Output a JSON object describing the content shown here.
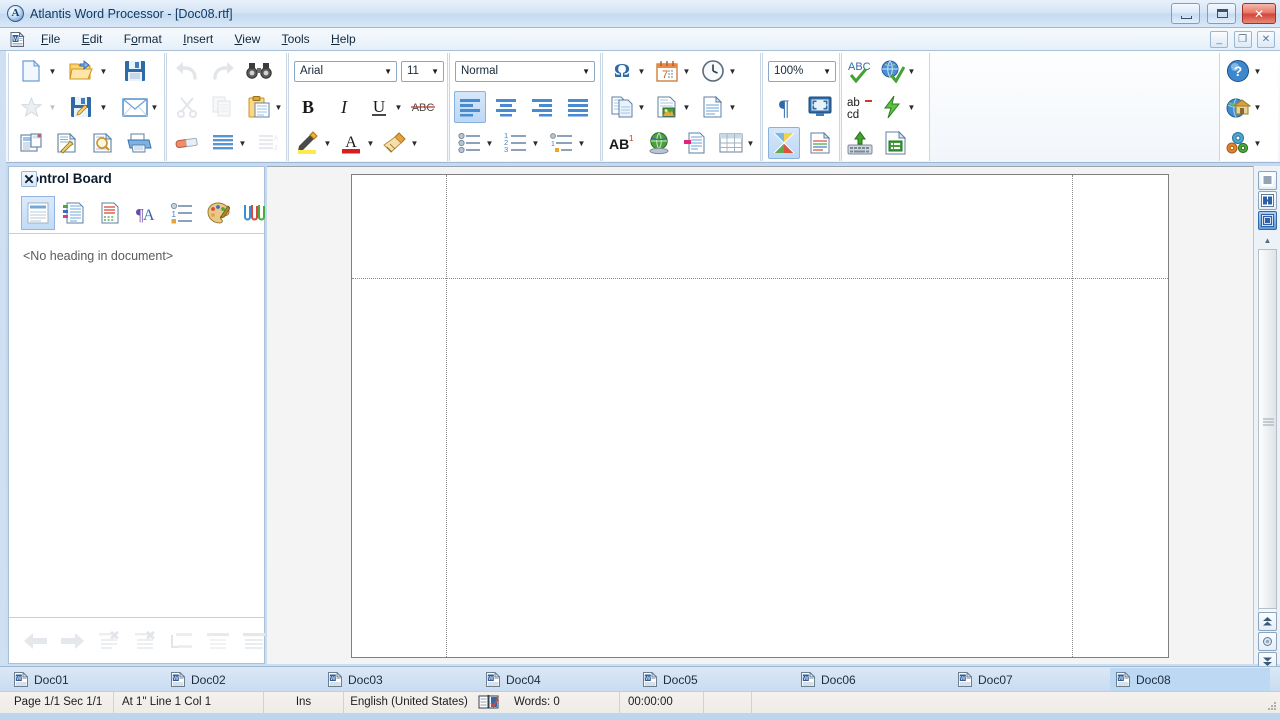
{
  "window": {
    "title": "Atlantis Word Processor - [Doc08.rtf]",
    "app_icon": "atlantis-logo-icon",
    "controls": [
      {
        "name": "minimize",
        "glyph": "minimize-icon"
      },
      {
        "name": "maximize",
        "glyph": "maximize-icon"
      },
      {
        "name": "close",
        "glyph": "✕"
      }
    ],
    "mdi_controls": [
      {
        "name": "mdi-minimize",
        "glyph": "_"
      },
      {
        "name": "mdi-restore",
        "glyph": "❐"
      },
      {
        "name": "mdi-close",
        "glyph": "✕"
      }
    ]
  },
  "menubar": {
    "doc_icon": "document-icon",
    "items": [
      {
        "label": "File",
        "accel": "F"
      },
      {
        "label": "Edit",
        "accel": "E"
      },
      {
        "label": "Format",
        "accel": "o"
      },
      {
        "label": "Insert",
        "accel": "I"
      },
      {
        "label": "View",
        "accel": "V"
      },
      {
        "label": "Tools",
        "accel": "T"
      },
      {
        "label": "Help",
        "accel": "H"
      }
    ]
  },
  "toolbar": {
    "font_name": {
      "value": "Arial",
      "placeholder": "Font"
    },
    "font_size": {
      "value": "11",
      "placeholder": "Size"
    },
    "style": {
      "value": "Normal",
      "placeholder": "Style"
    },
    "zoom": {
      "value": "100%",
      "placeholder": "Zoom"
    },
    "buttons": [
      {
        "name": "new-document-button",
        "icon": "new-page-icon",
        "dropdown": true,
        "enabled": true
      },
      {
        "name": "open-document-button",
        "icon": "open-folder-icon",
        "dropdown": true,
        "enabled": true
      },
      {
        "name": "save-button",
        "icon": "floppy-save-icon",
        "dropdown": false,
        "enabled": true
      },
      {
        "name": "favorites-button",
        "icon": "star-icon",
        "dropdown": true,
        "enabled": false
      },
      {
        "name": "save-as-button",
        "icon": "floppy-pencil-icon",
        "dropdown": true,
        "enabled": true
      },
      {
        "name": "send-mail-button",
        "icon": "envelope-icon",
        "dropdown": true,
        "enabled": true
      },
      {
        "name": "page-setup-button",
        "icon": "page-layout-icon",
        "dropdown": false,
        "enabled": true
      },
      {
        "name": "document-options-button",
        "icon": "page-wrench-icon",
        "dropdown": false,
        "enabled": true
      },
      {
        "name": "print-preview-button",
        "icon": "page-magnifier-icon",
        "dropdown": false,
        "enabled": true
      },
      {
        "name": "print-button",
        "icon": "printer-icon",
        "dropdown": false,
        "enabled": true
      },
      {
        "name": "undo-button",
        "icon": "undo-arrow-icon",
        "dropdown": false,
        "enabled": false
      },
      {
        "name": "redo-button",
        "icon": "redo-arrow-icon",
        "dropdown": false,
        "enabled": false
      },
      {
        "name": "find-button",
        "icon": "binoculars-icon",
        "dropdown": false,
        "enabled": true
      },
      {
        "name": "cut-button",
        "icon": "scissors-icon",
        "dropdown": false,
        "enabled": false
      },
      {
        "name": "copy-button",
        "icon": "copy-pages-icon",
        "dropdown": false,
        "enabled": false
      },
      {
        "name": "paste-button",
        "icon": "clipboard-paste-icon",
        "dropdown": true,
        "enabled": true
      },
      {
        "name": "clear-formatting-button",
        "icon": "eraser-icon",
        "dropdown": false,
        "enabled": true
      },
      {
        "name": "paragraph-format-button",
        "icon": "lines-block-icon",
        "dropdown": true,
        "enabled": true
      },
      {
        "name": "sort-button",
        "icon": "sort-lines-icon",
        "dropdown": false,
        "enabled": false
      },
      {
        "name": "bold-button",
        "icon": "bold-icon",
        "dropdown": false,
        "enabled": true
      },
      {
        "name": "italic-button",
        "icon": "italic-icon",
        "dropdown": false,
        "enabled": true
      },
      {
        "name": "underline-button",
        "icon": "underline-icon",
        "dropdown": true,
        "enabled": true
      },
      {
        "name": "strikethrough-button",
        "icon": "strikethrough-icon",
        "dropdown": false,
        "enabled": true
      },
      {
        "name": "highlight-button",
        "icon": "highlighter-pen-icon",
        "dropdown": true,
        "enabled": true
      },
      {
        "name": "font-color-button",
        "icon": "font-color-icon",
        "dropdown": true,
        "enabled": true
      },
      {
        "name": "format-painter-button",
        "icon": "paint-brush-icon",
        "dropdown": true,
        "enabled": true
      },
      {
        "name": "align-left-button",
        "icon": "align-left-icon",
        "dropdown": false,
        "enabled": true,
        "selected": true
      },
      {
        "name": "align-center-button",
        "icon": "align-center-icon",
        "dropdown": false,
        "enabled": true
      },
      {
        "name": "align-right-button",
        "icon": "align-right-icon",
        "dropdown": false,
        "enabled": true
      },
      {
        "name": "align-justify-button",
        "icon": "align-justify-icon",
        "dropdown": false,
        "enabled": true
      },
      {
        "name": "bullet-list-button",
        "icon": "bullet-list-icon",
        "dropdown": true,
        "enabled": true
      },
      {
        "name": "numbered-list-button",
        "icon": "numbered-list-icon",
        "dropdown": true,
        "enabled": true
      },
      {
        "name": "multilevel-list-button",
        "icon": "multilevel-list-icon",
        "dropdown": true,
        "enabled": true
      },
      {
        "name": "insert-symbol-button",
        "icon": "omega-symbol-icon",
        "dropdown": true,
        "enabled": true
      },
      {
        "name": "insert-date-button",
        "icon": "calendar-icon",
        "dropdown": true,
        "enabled": true
      },
      {
        "name": "insert-time-button",
        "icon": "clock-icon",
        "dropdown": true,
        "enabled": true
      },
      {
        "name": "insert-page-break-button",
        "icon": "page-break-icon",
        "dropdown": true,
        "enabled": true
      },
      {
        "name": "insert-image-button",
        "icon": "page-image-icon",
        "dropdown": true,
        "enabled": true
      },
      {
        "name": "insert-text-box-button",
        "icon": "text-frame-icon",
        "dropdown": true,
        "enabled": true
      },
      {
        "name": "footnote-button",
        "icon": "footnote-ab-icon",
        "dropdown": false,
        "enabled": true
      },
      {
        "name": "hyperlink-button",
        "icon": "globe-link-icon",
        "dropdown": false,
        "enabled": true
      },
      {
        "name": "bookmark-button",
        "icon": "bookmark-page-icon",
        "dropdown": false,
        "enabled": true
      },
      {
        "name": "insert-table-button",
        "icon": "table-grid-icon",
        "dropdown": true,
        "enabled": true
      },
      {
        "name": "show-formatting-marks-button",
        "icon": "pilcrow-icon",
        "dropdown": false,
        "enabled": true
      },
      {
        "name": "full-screen-button",
        "icon": "monitor-fullscreen-icon",
        "dropdown": false,
        "enabled": true
      },
      {
        "name": "color-scheme-button",
        "icon": "color-pinwheel-icon",
        "dropdown": false,
        "enabled": true,
        "selected": true
      },
      {
        "name": "page-colors-button",
        "icon": "page-colored-lines-icon",
        "dropdown": false,
        "enabled": true
      },
      {
        "name": "spell-check-button",
        "icon": "abc-spellcheck-icon",
        "dropdown": false,
        "enabled": true
      },
      {
        "name": "language-button",
        "icon": "globe-check-icon",
        "dropdown": true,
        "enabled": true
      },
      {
        "name": "thesaurus-button",
        "icon": "abcd-replace-icon",
        "dropdown": false,
        "enabled": true
      },
      {
        "name": "autocorrect-button",
        "icon": "lightning-bolt-icon",
        "dropdown": true,
        "enabled": true
      },
      {
        "name": "keyboard-shortcuts-button",
        "icon": "keyboard-up-icon",
        "dropdown": false,
        "enabled": true
      },
      {
        "name": "word-count-button",
        "icon": "page-info-icon",
        "dropdown": false,
        "enabled": true
      },
      {
        "name": "help-button",
        "icon": "question-mark-icon",
        "dropdown": true,
        "enabled": true
      },
      {
        "name": "home-page-button",
        "icon": "globe-house-icon",
        "dropdown": true,
        "enabled": true
      },
      {
        "name": "options-button",
        "icon": "gears-icon",
        "dropdown": true,
        "enabled": true
      }
    ]
  },
  "control_board": {
    "title": "Control Board",
    "close_glyph": "✕",
    "tabs": [
      {
        "name": "tab-headings",
        "icon": "headings-outline-icon",
        "selected": true
      },
      {
        "name": "tab-document-map",
        "icon": "document-map-icon",
        "selected": false
      },
      {
        "name": "tab-spelling",
        "icon": "spelling-page-icon",
        "selected": false
      },
      {
        "name": "tab-styles",
        "icon": "styles-ta-icon",
        "selected": false
      },
      {
        "name": "tab-lists",
        "icon": "list-numbered-icon",
        "selected": false
      },
      {
        "name": "tab-themes",
        "icon": "palette-icon",
        "selected": false
      },
      {
        "name": "tab-clips",
        "icon": "paperclips-icon",
        "selected": false
      }
    ],
    "empty_message": "<No heading in document>",
    "footer_buttons": [
      {
        "name": "nav-back-button",
        "icon": "left-arrow-icon",
        "enabled": false
      },
      {
        "name": "nav-forward-button",
        "icon": "right-arrow-icon",
        "enabled": false
      },
      {
        "name": "delete-heading-button",
        "icon": "delete-heading-icon",
        "enabled": false
      },
      {
        "name": "delete-section-button",
        "icon": "delete-section-icon",
        "enabled": false
      },
      {
        "name": "promote-heading-button",
        "icon": "promote-heading-icon",
        "enabled": false
      },
      {
        "name": "collapse-all-button",
        "icon": "collapse-all-icon",
        "enabled": false
      },
      {
        "name": "expand-all-button",
        "icon": "expand-all-icon",
        "enabled": false
      }
    ]
  },
  "rail": {
    "view_buttons": [
      {
        "name": "normal-view-button",
        "icon": "normal-view-icon",
        "selected": false
      },
      {
        "name": "two-page-view-button",
        "icon": "two-page-view-icon",
        "selected": false
      },
      {
        "name": "page-view-button",
        "icon": "page-view-icon",
        "selected": true
      }
    ],
    "scroll_buttons": [
      {
        "name": "scroll-up-button",
        "icon": "up-triangle-icon"
      },
      {
        "name": "previous-page-button",
        "icon": "double-up-icon"
      },
      {
        "name": "browse-object-button",
        "icon": "browse-circle-icon"
      },
      {
        "name": "next-page-button",
        "icon": "double-down-icon"
      }
    ]
  },
  "document_tabs": [
    {
      "name": "doc-tab-1",
      "label": "Doc01",
      "icon": "word-doc-icon",
      "selected": false
    },
    {
      "name": "doc-tab-2",
      "label": "Doc02",
      "icon": "word-doc-icon",
      "selected": false
    },
    {
      "name": "doc-tab-3",
      "label": "Doc03",
      "icon": "word-doc-icon",
      "selected": false
    },
    {
      "name": "doc-tab-4",
      "label": "Doc04",
      "icon": "word-doc-icon",
      "selected": false
    },
    {
      "name": "doc-tab-5",
      "label": "Doc05",
      "icon": "word-doc-icon",
      "selected": false
    },
    {
      "name": "doc-tab-6",
      "label": "Doc06",
      "icon": "word-doc-icon",
      "selected": false
    },
    {
      "name": "doc-tab-7",
      "label": "Doc07",
      "icon": "word-doc-icon",
      "selected": false
    },
    {
      "name": "doc-tab-8",
      "label": "Doc08",
      "icon": "word-doc-icon",
      "selected": true
    }
  ],
  "statusbar": {
    "page": "Page 1/1   Sec 1/1",
    "position": "At 1\"  Line 1  Col 1",
    "insert_mode": "Ins",
    "language": "English (United States)",
    "spell_icon": "spell-book-icon",
    "words": "Words: 0",
    "timer": "00:00:00"
  },
  "colors": {
    "accent": "#3a6ea5",
    "selection": "#bcd8f3",
    "title_text": "#113a63",
    "page_white": "#ffffff",
    "workspace": "#f4f4f4"
  }
}
